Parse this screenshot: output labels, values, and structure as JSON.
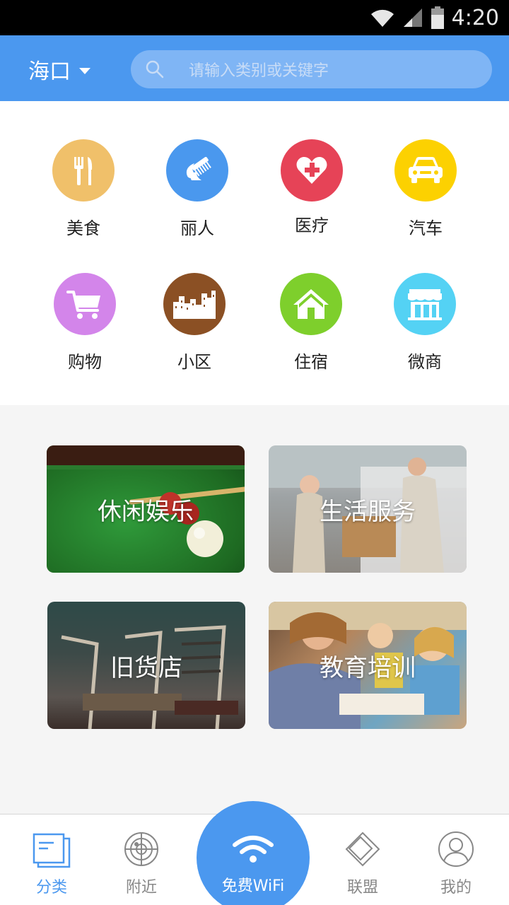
{
  "status_bar": {
    "time": "4:20"
  },
  "header": {
    "city": "海口",
    "search_placeholder": "请输入类别或关键字"
  },
  "categories": [
    {
      "label": "美食",
      "icon": "utensils-icon",
      "color": "#f0c06a"
    },
    {
      "label": "丽人",
      "icon": "comb-icon",
      "color": "#4a98ee"
    },
    {
      "label": "医疗",
      "icon": "medical-heart-icon",
      "color": "#e64357"
    },
    {
      "label": "汽车",
      "icon": "car-icon",
      "color": "#fcd101"
    },
    {
      "label": "购物",
      "icon": "shopping-cart-icon",
      "color": "#d385ea"
    },
    {
      "label": "小区",
      "icon": "buildings-icon",
      "color": "#8b5024"
    },
    {
      "label": "住宿",
      "icon": "house-icon",
      "color": "#7ecf2c"
    },
    {
      "label": "微商",
      "icon": "storefront-icon",
      "color": "#54d2f4"
    }
  ],
  "tiles": [
    {
      "label": "休闲娱乐"
    },
    {
      "label": "生活服务"
    },
    {
      "label": "旧货店"
    },
    {
      "label": "教育培训"
    }
  ],
  "bottom_nav": {
    "items": [
      {
        "label": "分类",
        "icon": "category-list-icon",
        "active": true
      },
      {
        "label": "附近",
        "icon": "radar-icon",
        "active": false
      },
      {
        "label": "联盟",
        "icon": "diamond-icon",
        "active": false
      },
      {
        "label": "我的",
        "icon": "user-icon",
        "active": false
      }
    ],
    "wifi_label": "免费WiFi",
    "accent_color": "#4b98ef"
  }
}
